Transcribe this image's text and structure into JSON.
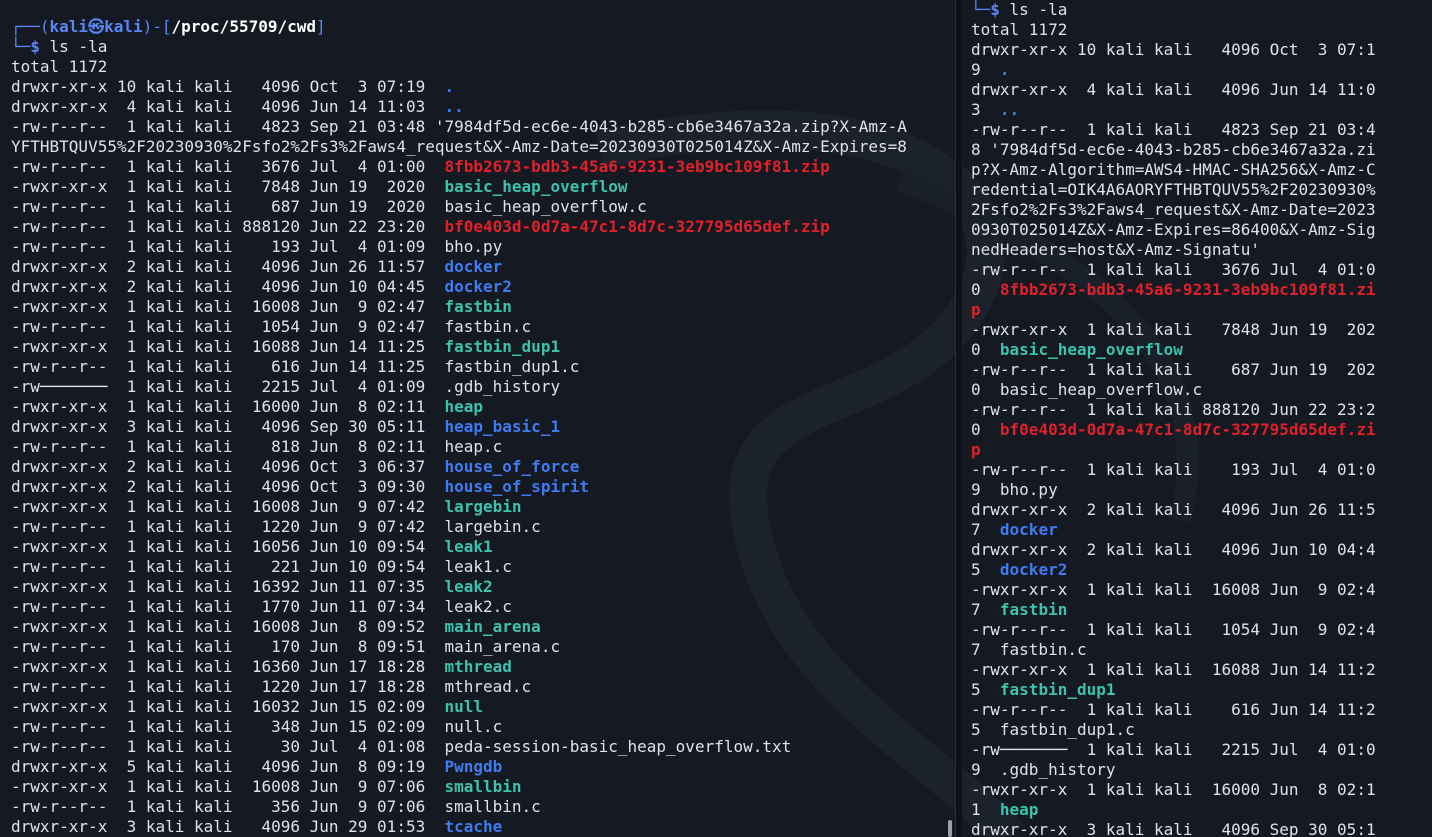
{
  "colors": {
    "background": "#141922",
    "text": "#dfe2ea",
    "prompt_frame": "#5a86f5",
    "directory": "#3f7cf0",
    "executable": "#3cc2ad",
    "archive": "#e0202a"
  },
  "left_pane": {
    "prompt": {
      "frame_top": "┌──(",
      "user_host": "kali㉿kali",
      "sep": ")-[",
      "cwd": "/proc/55709/cwd",
      "close": "]",
      "frame_bottom": "└─",
      "dollar": "$",
      "command": " ls -la"
    },
    "lines": [
      {
        "meta": "total 1172",
        "name": "",
        "type": "plain"
      },
      {
        "meta": "drwxr-xr-x 10 kali kali   4096 Oct  3 07:19  ",
        "name": ".",
        "type": "dot"
      },
      {
        "meta": "drwxr-xr-x  4 kali kali   4096 Jun 14 11:03  ",
        "name": "..",
        "type": "dot"
      },
      {
        "meta": "-rw-r--r--  1 kali kali   4823 Sep 21 03:48 ",
        "name": "'7984df5d-ec6e-4043-b285-cb6e3467a32a.zip?X-Amz-A",
        "type": "plain"
      },
      {
        "meta": "YFTHBTQUV55%2F20230930%2Fsfo2%2Fs3%2Faws4_request&X-Amz-Date=20230930T025014Z&X-Amz-Expires=8",
        "name": "",
        "type": "plain"
      },
      {
        "meta": "-rw-r--r--  1 kali kali   3676 Jul  4 01:00  ",
        "name": "8fbb2673-bdb3-45a6-9231-3eb9bc109f81.zip",
        "type": "zip"
      },
      {
        "meta": "-rwxr-xr-x  1 kali kali   7848 Jun 19  2020  ",
        "name": "basic_heap_overflow",
        "type": "exe"
      },
      {
        "meta": "-rw-r--r--  1 kali kali    687 Jun 19  2020  ",
        "name": "basic_heap_overflow.c",
        "type": "plain"
      },
      {
        "meta": "-rw-r--r--  1 kali kali 888120 Jun 22 23:20  ",
        "name": "bf0e403d-0d7a-47c1-8d7c-327795d65def.zip",
        "type": "zip"
      },
      {
        "meta": "-rw-r--r--  1 kali kali    193 Jul  4 01:09  ",
        "name": "bho.py",
        "type": "plain"
      },
      {
        "meta": "drwxr-xr-x  2 kali kali   4096 Jun 26 11:57  ",
        "name": "docker",
        "type": "dir"
      },
      {
        "meta": "drwxr-xr-x  2 kali kali   4096 Jun 10 04:45  ",
        "name": "docker2",
        "type": "dir"
      },
      {
        "meta": "-rwxr-xr-x  1 kali kali  16008 Jun  9 02:47  ",
        "name": "fastbin",
        "type": "exe"
      },
      {
        "meta": "-rw-r--r--  1 kali kali   1054 Jun  9 02:47  ",
        "name": "fastbin.c",
        "type": "plain"
      },
      {
        "meta": "-rwxr-xr-x  1 kali kali  16088 Jun 14 11:25  ",
        "name": "fastbin_dup1",
        "type": "exe"
      },
      {
        "meta": "-rw-r--r--  1 kali kali    616 Jun 14 11:25  ",
        "name": "fastbin_dup1.c",
        "type": "plain"
      },
      {
        "meta": "-rw───────  1 kali kali   2215 Jul  4 01:09  ",
        "name": ".gdb_history",
        "type": "plain"
      },
      {
        "meta": "-rwxr-xr-x  1 kali kali  16000 Jun  8 02:11  ",
        "name": "heap",
        "type": "exe"
      },
      {
        "meta": "drwxr-xr-x  3 kali kali   4096 Sep 30 05:11  ",
        "name": "heap_basic_1",
        "type": "dir"
      },
      {
        "meta": "-rw-r--r--  1 kali kali    818 Jun  8 02:11  ",
        "name": "heap.c",
        "type": "plain"
      },
      {
        "meta": "drwxr-xr-x  2 kali kali   4096 Oct  3 06:37  ",
        "name": "house_of_force",
        "type": "dir"
      },
      {
        "meta": "drwxr-xr-x  2 kali kali   4096 Oct  3 09:30  ",
        "name": "house_of_spirit",
        "type": "dir"
      },
      {
        "meta": "-rwxr-xr-x  1 kali kali  16008 Jun  9 07:42  ",
        "name": "largebin",
        "type": "exe"
      },
      {
        "meta": "-rw-r--r--  1 kali kali   1220 Jun  9 07:42  ",
        "name": "largebin.c",
        "type": "plain"
      },
      {
        "meta": "-rwxr-xr-x  1 kali kali  16056 Jun 10 09:54  ",
        "name": "leak1",
        "type": "exe"
      },
      {
        "meta": "-rw-r--r--  1 kali kali    221 Jun 10 09:54  ",
        "name": "leak1.c",
        "type": "plain"
      },
      {
        "meta": "-rwxr-xr-x  1 kali kali  16392 Jun 11 07:35  ",
        "name": "leak2",
        "type": "exe"
      },
      {
        "meta": "-rw-r--r--  1 kali kali   1770 Jun 11 07:34  ",
        "name": "leak2.c",
        "type": "plain"
      },
      {
        "meta": "-rwxr-xr-x  1 kali kali  16008 Jun  8 09:52  ",
        "name": "main_arena",
        "type": "exe"
      },
      {
        "meta": "-rw-r--r--  1 kali kali    170 Jun  8 09:51  ",
        "name": "main_arena.c",
        "type": "plain"
      },
      {
        "meta": "-rwxr-xr-x  1 kali kali  16360 Jun 17 18:28  ",
        "name": "mthread",
        "type": "exe"
      },
      {
        "meta": "-rw-r--r--  1 kali kali   1220 Jun 17 18:28  ",
        "name": "mthread.c",
        "type": "plain"
      },
      {
        "meta": "-rwxr-xr-x  1 kali kali  16032 Jun 15 02:09  ",
        "name": "null",
        "type": "exe"
      },
      {
        "meta": "-rw-r--r--  1 kali kali    348 Jun 15 02:09  ",
        "name": "null.c",
        "type": "plain"
      },
      {
        "meta": "-rw-r--r--  1 kali kali     30 Jul  4 01:08  ",
        "name": "peda-session-basic_heap_overflow.txt",
        "type": "plain"
      },
      {
        "meta": "drwxr-xr-x  5 kali kali   4096 Jun  8 09:19  ",
        "name": "Pwngdb",
        "type": "dir"
      },
      {
        "meta": "-rwxr-xr-x  1 kali kali  16008 Jun  9 07:06  ",
        "name": "smallbin",
        "type": "exe"
      },
      {
        "meta": "-rw-r--r--  1 kali kali    356 Jun  9 07:06  ",
        "name": "smallbin.c",
        "type": "plain"
      },
      {
        "meta": "drwxr-xr-x  3 kali kali   4096 Jun 29 01:53  ",
        "name": "tcache",
        "type": "dir"
      }
    ]
  },
  "right_pane": {
    "prompt": {
      "frame_bottom": "└─",
      "dollar": "$",
      "command": " ls -la"
    },
    "lines": [
      {
        "meta": "total 1172",
        "name": "",
        "type": "plain"
      },
      {
        "meta": "drwxr-xr-x 10 kali kali   4096 Oct  3 07:1",
        "name": "",
        "type": "plain"
      },
      {
        "meta": "9  ",
        "name": ".",
        "type": "dot"
      },
      {
        "meta": "drwxr-xr-x  4 kali kali   4096 Jun 14 11:0",
        "name": "",
        "type": "plain"
      },
      {
        "meta": "3  ",
        "name": "..",
        "type": "dot"
      },
      {
        "meta": "-rw-r--r--  1 kali kali   4823 Sep 21 03:4",
        "name": "",
        "type": "plain"
      },
      {
        "meta": "8 '7984df5d-ec6e-4043-b285-cb6e3467a32a.zi",
        "name": "",
        "type": "plain"
      },
      {
        "meta": "p?X-Amz-Algorithm=AWS4-HMAC-SHA256&X-Amz-C",
        "name": "",
        "type": "plain"
      },
      {
        "meta": "redential=OIK4A6AORYFTHBTQUV55%2F20230930%",
        "name": "",
        "type": "plain"
      },
      {
        "meta": "2Fsfo2%2Fs3%2Faws4_request&X-Amz-Date=2023",
        "name": "",
        "type": "plain"
      },
      {
        "meta": "0930T025014Z&X-Amz-Expires=86400&X-Amz-Sig",
        "name": "",
        "type": "plain"
      },
      {
        "meta": "nedHeaders=host&X-Amz-Signatu'",
        "name": "",
        "type": "plain"
      },
      {
        "meta": "-rw-r--r--  1 kali kali   3676 Jul  4 01:0",
        "name": "",
        "type": "plain"
      },
      {
        "meta": "0  ",
        "name": "8fbb2673-bdb3-45a6-9231-3eb9bc109f81.zi",
        "type": "zip"
      },
      {
        "meta": "",
        "name": "p",
        "type": "zip"
      },
      {
        "meta": "-rwxr-xr-x  1 kali kali   7848 Jun 19  202",
        "name": "",
        "type": "plain"
      },
      {
        "meta": "0  ",
        "name": "basic_heap_overflow",
        "type": "exe"
      },
      {
        "meta": "-rw-r--r--  1 kali kali    687 Jun 19  202",
        "name": "",
        "type": "plain"
      },
      {
        "meta": "0  basic_heap_overflow.c",
        "name": "",
        "type": "plain"
      },
      {
        "meta": "-rw-r--r--  1 kali kali 888120 Jun 22 23:2",
        "name": "",
        "type": "plain"
      },
      {
        "meta": "0  ",
        "name": "bf0e403d-0d7a-47c1-8d7c-327795d65def.zi",
        "type": "zip"
      },
      {
        "meta": "",
        "name": "p",
        "type": "zip"
      },
      {
        "meta": "-rw-r--r--  1 kali kali    193 Jul  4 01:0",
        "name": "",
        "type": "plain"
      },
      {
        "meta": "9  bho.py",
        "name": "",
        "type": "plain"
      },
      {
        "meta": "drwxr-xr-x  2 kali kali   4096 Jun 26 11:5",
        "name": "",
        "type": "plain"
      },
      {
        "meta": "7  ",
        "name": "docker",
        "type": "dir"
      },
      {
        "meta": "drwxr-xr-x  2 kali kali   4096 Jun 10 04:4",
        "name": "",
        "type": "plain"
      },
      {
        "meta": "5  ",
        "name": "docker2",
        "type": "dir"
      },
      {
        "meta": "-rwxr-xr-x  1 kali kali  16008 Jun  9 02:4",
        "name": "",
        "type": "plain"
      },
      {
        "meta": "7  ",
        "name": "fastbin",
        "type": "exe"
      },
      {
        "meta": "-rw-r--r--  1 kali kali   1054 Jun  9 02:4",
        "name": "",
        "type": "plain"
      },
      {
        "meta": "7  fastbin.c",
        "name": "",
        "type": "plain"
      },
      {
        "meta": "-rwxr-xr-x  1 kali kali  16088 Jun 14 11:2",
        "name": "",
        "type": "plain"
      },
      {
        "meta": "5  ",
        "name": "fastbin_dup1",
        "type": "exe"
      },
      {
        "meta": "-rw-r--r--  1 kali kali    616 Jun 14 11:2",
        "name": "",
        "type": "plain"
      },
      {
        "meta": "5  fastbin_dup1.c",
        "name": "",
        "type": "plain"
      },
      {
        "meta": "-rw───────  1 kali kali   2215 Jul  4 01:0",
        "name": "",
        "type": "plain"
      },
      {
        "meta": "9  .gdb_history",
        "name": "",
        "type": "plain"
      },
      {
        "meta": "-rwxr-xr-x  1 kali kali  16000 Jun  8 02:1",
        "name": "",
        "type": "plain"
      },
      {
        "meta": "1  ",
        "name": "heap",
        "type": "exe"
      },
      {
        "meta": "drwxr-xr-x  3 kali kali   4096 Sep 30 05:1",
        "name": "",
        "type": "plain"
      }
    ]
  }
}
